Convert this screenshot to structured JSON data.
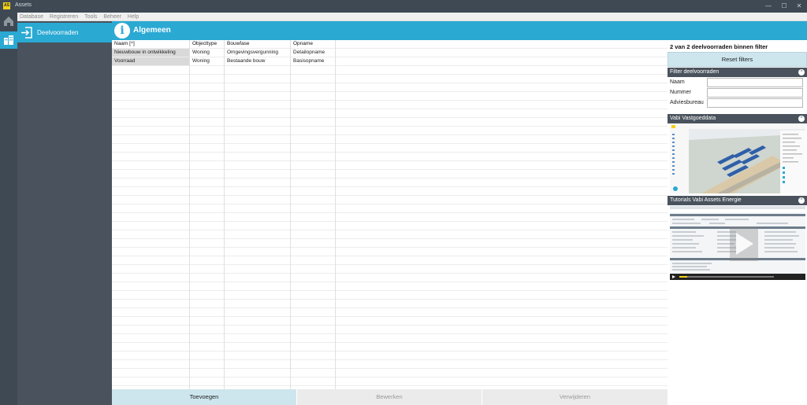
{
  "window": {
    "title": "Assets",
    "logo": "AS",
    "controls": [
      "—",
      "☐",
      "✕"
    ]
  },
  "menu": [
    "Database",
    "Registreren",
    "Tools",
    "Beheer",
    "Help"
  ],
  "rail": {
    "icons": [
      "home-icon",
      "buildings-icon"
    ]
  },
  "nav": {
    "item_label": "Deelvoorraden"
  },
  "header": {
    "info_glyph": "i",
    "title": "Algemeen"
  },
  "table": {
    "headers": [
      "Naam [^]",
      "Objecttype",
      "Bouwfase",
      "Opname"
    ],
    "rows": [
      [
        "Nieuwbouw in ontwikkeling",
        "Woning",
        "Omgevingsvergunning",
        "Detailopname"
      ],
      [
        "Voorraad",
        "Woning",
        "Bestaande bouw",
        "Basisopname"
      ]
    ]
  },
  "right": {
    "count_text": "2 van 2 deelvoorraden binnen filter",
    "reset_label": "Reset filters",
    "filter": {
      "title": "Filter deelvoorraden",
      "fields": [
        {
          "label": "Naam",
          "value": ""
        },
        {
          "label": "Nummer",
          "value": ""
        },
        {
          "label": "Adviesbureau",
          "value": ""
        }
      ]
    },
    "vastgoed": {
      "title": "Vabi Vastgoeddata"
    },
    "tutorials": {
      "title": "Tutorials Vabi Assets Energie"
    },
    "toggle_glyph": "^"
  },
  "actions": {
    "add": "Toevoegen",
    "edit": "Bewerken",
    "delete": "Verwijderen"
  },
  "colors": {
    "accent": "#2aa9d3",
    "dark": "#3f4954",
    "panel": "#4a535d",
    "button": "#cde6ee"
  }
}
